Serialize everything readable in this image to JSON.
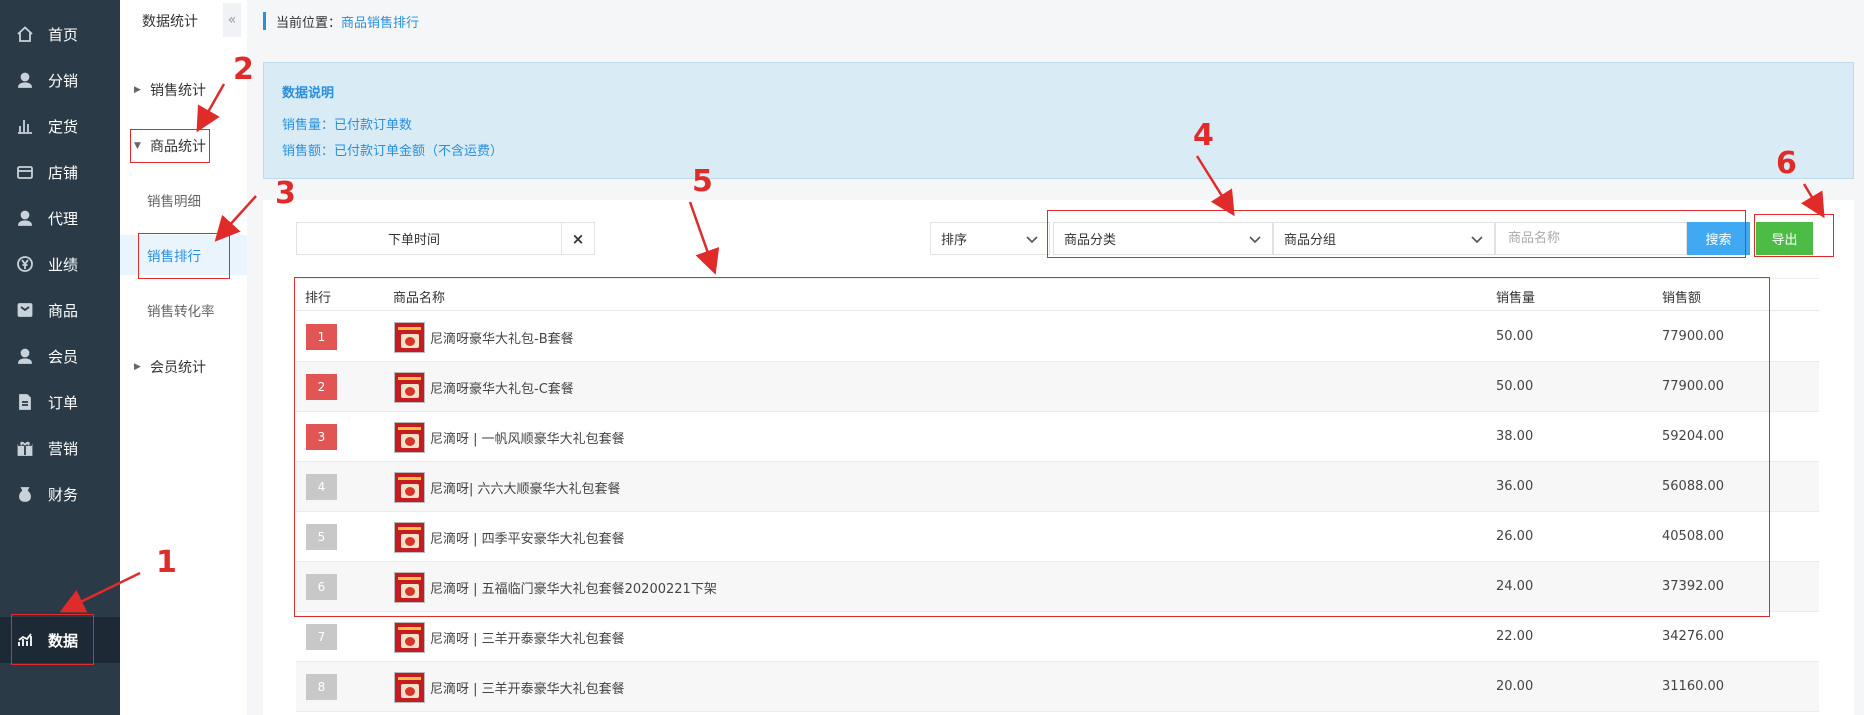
{
  "nav": {
    "items": [
      {
        "label": "首页",
        "icon": "home-icon"
      },
      {
        "label": "分销",
        "icon": "user-icon"
      },
      {
        "label": "定货",
        "icon": "bar-chart-icon"
      },
      {
        "label": "店铺",
        "icon": "store-icon"
      },
      {
        "label": "代理",
        "icon": "agent-icon"
      },
      {
        "label": "业绩",
        "icon": "yen-icon"
      },
      {
        "label": "商品",
        "icon": "goods-icon"
      },
      {
        "label": "会员",
        "icon": "member-icon"
      },
      {
        "label": "订单",
        "icon": "order-icon"
      },
      {
        "label": "营销",
        "icon": "gift-icon"
      },
      {
        "label": "财务",
        "icon": "money-bag-icon"
      },
      {
        "label": "数据",
        "icon": "data-chart-icon",
        "active": true
      }
    ]
  },
  "subnav": {
    "title": "数据统计",
    "collapse_glyph": "«",
    "groups": [
      {
        "label": "销售统计",
        "expanded": false
      },
      {
        "label": "商品统计",
        "expanded": true,
        "children": [
          "销售明细",
          "销售排行",
          "销售转化率"
        ]
      },
      {
        "label": "会员统计",
        "expanded": false
      }
    ],
    "active_child": "销售排行"
  },
  "breadcrumb": {
    "prefix": "当前位置：",
    "current": "商品销售排行"
  },
  "info": {
    "title": "数据说明",
    "lines": [
      "销售量：已付款订单数",
      "销售额：已付款订单金额（不含运费）"
    ]
  },
  "filters": {
    "date_label": "下单时间",
    "clear_glyph": "×",
    "sort_label": "排序",
    "category_label": "商品分类",
    "group_label": "商品分组",
    "name_placeholder": "商品名称",
    "search_button": "搜索",
    "export_button": "导出"
  },
  "table": {
    "headers": [
      "排行",
      "商品名称",
      "销售量",
      "销售额"
    ],
    "rows": [
      {
        "rank": "1",
        "name": "尼滴呀豪华大礼包-B套餐",
        "qty": "50.00",
        "amount": "77900.00"
      },
      {
        "rank": "2",
        "name": "尼滴呀豪华大礼包-C套餐",
        "qty": "50.00",
        "amount": "77900.00"
      },
      {
        "rank": "3",
        "name": "尼滴呀 | 一帆风顺豪华大礼包套餐",
        "qty": "38.00",
        "amount": "59204.00"
      },
      {
        "rank": "4",
        "name": "尼滴呀| 六六大顺豪华大礼包套餐",
        "qty": "36.00",
        "amount": "56088.00"
      },
      {
        "rank": "5",
        "name": "尼滴呀 | 四季平安豪华大礼包套餐",
        "qty": "26.00",
        "amount": "40508.00"
      },
      {
        "rank": "6",
        "name": "尼滴呀 | 五福临门豪华大礼包套餐20200221下架",
        "qty": "24.00",
        "amount": "37392.00"
      },
      {
        "rank": "7",
        "name": "尼滴呀 | 三羊开泰豪华大礼包套餐",
        "qty": "22.00",
        "amount": "34276.00"
      },
      {
        "rank": "8",
        "name": "尼滴呀 | 三羊开泰豪华大礼包套餐",
        "qty": "20.00",
        "amount": "31160.00"
      }
    ]
  },
  "annotations": [
    "1",
    "2",
    "3",
    "4",
    "5",
    "6"
  ],
  "colors": {
    "nav_bg": "#2b3a47",
    "accent": "#2a8fdc",
    "rank_top": "#e25555",
    "rank_other": "#c8c8c8",
    "search_btn": "#40a9f1",
    "export_btn": "#4dbc46",
    "annotation": "#e02b2b"
  }
}
